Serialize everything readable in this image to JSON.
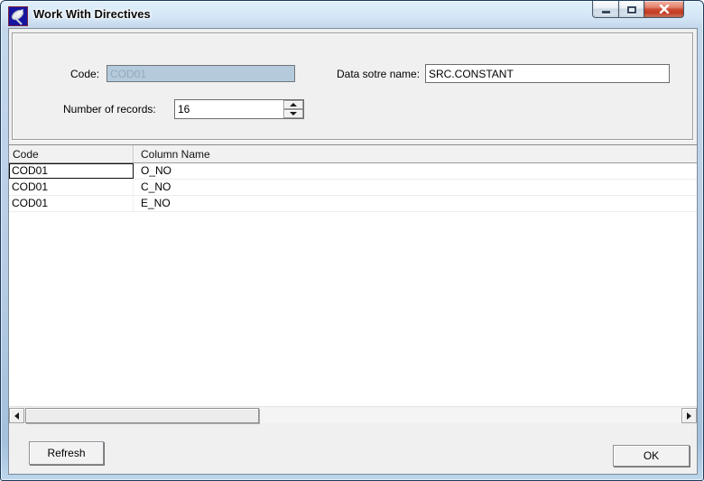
{
  "window": {
    "title": "Work With Directives",
    "icons": {
      "app": "satellite-dish",
      "minimize": "minimize",
      "maximize": "maximize-restore",
      "close": "close"
    }
  },
  "form": {
    "code_label": "Code:",
    "code_value": "COD01",
    "datastore_label": "Data sotre name:",
    "datastore_value": "SRC.CONSTANT",
    "records_label": "Number of records:",
    "records_value": "16"
  },
  "table": {
    "columns": [
      "Code",
      "Column Name"
    ],
    "rows": [
      [
        "COD01",
        "O_NO"
      ],
      [
        "COD01",
        "C_NO"
      ],
      [
        "COD01",
        "E_NO"
      ]
    ]
  },
  "buttons": {
    "refresh": "Refresh",
    "ok": "OK"
  },
  "colors": {
    "disabled_field_bg": "#b5cbdc",
    "disabled_field_text": "#93abbf",
    "close_button": "#cc4a31",
    "titlebar_glass": "#c4d8ec",
    "client_bg": "#f0f0f0"
  }
}
